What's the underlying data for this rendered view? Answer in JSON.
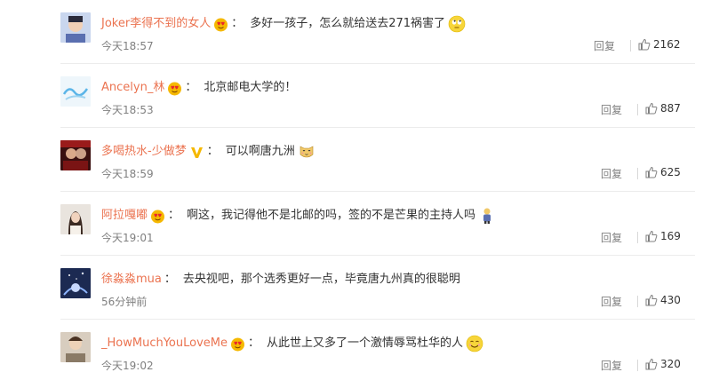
{
  "comments": [
    {
      "username": "Joker李得不到的女人",
      "badge": "red-heart-face-badge",
      "text": "多好一孩子，怎么就给送去271祸害了",
      "emoji": "rolling-eyes-emoji",
      "time": "今天18:57",
      "reply_label": "回复",
      "likes": "2162"
    },
    {
      "username": "Ancelyn_林",
      "badge": "red-heart-face-badge",
      "text": "北京邮电大学的！",
      "emoji": "",
      "time": "今天18:53",
      "reply_label": "回复",
      "likes": "887"
    },
    {
      "username": "多喝热水-少做梦",
      "badge": "yellow-v-badge",
      "text": "可以啊唐九洲",
      "emoji": "cat-face-emoji",
      "time": "今天18:59",
      "reply_label": "回复",
      "likes": "625"
    },
    {
      "username": "阿拉嘎嘟",
      "badge": "red-heart-face-badge",
      "text": "啊这，我记得他不是北邮的吗，签的不是芒果的主持人吗",
      "emoji": "figure-emoji",
      "time": "今天19:01",
      "reply_label": "回复",
      "likes": "169"
    },
    {
      "username": "徐淼淼mua",
      "badge": "",
      "text": "去央视吧，那个选秀更好一点，毕竟唐九州真的很聪明",
      "emoji": "",
      "time": "56分钟前",
      "reply_label": "回复",
      "likes": "430"
    },
    {
      "username": "_HowMuchYouLoveMe",
      "badge": "red-heart-face-badge",
      "text": "从此世上又多了一个激情辱骂杜华的人",
      "emoji": "smiling-face-emoji",
      "time": "今天19:02",
      "reply_label": "回复",
      "likes": "320"
    }
  ],
  "colors": {
    "username": "#eb7350",
    "body_text": "#333333",
    "meta_text": "#808080",
    "separator": "#ececec"
  }
}
